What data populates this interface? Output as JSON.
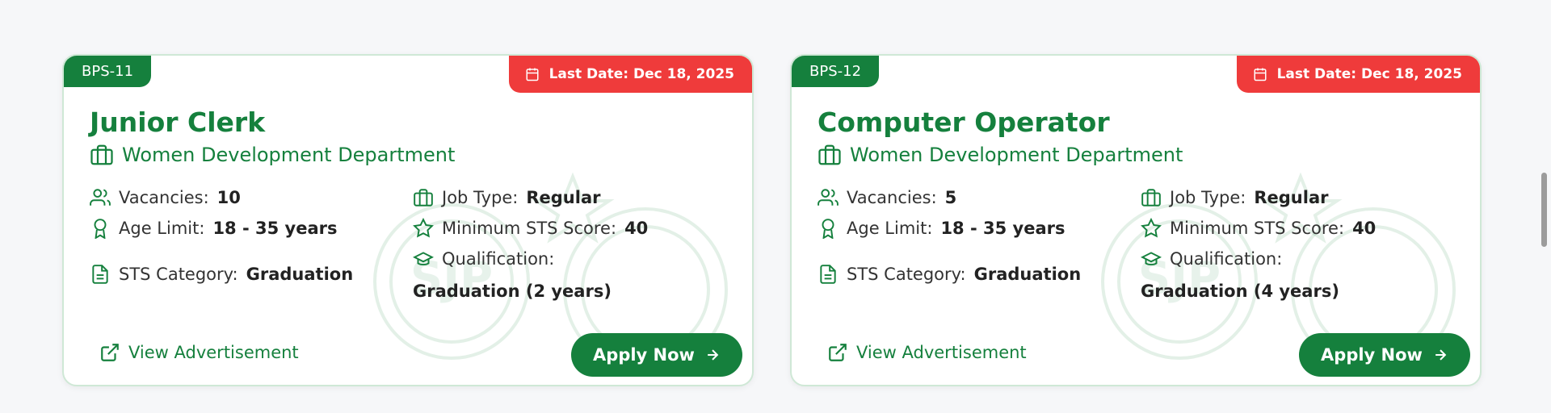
{
  "cards": [
    {
      "bps": "BPS-11",
      "last_date": "Last Date: Dec 18, 2025",
      "title": "Junior Clerk",
      "department": "Women Development Department",
      "vacancies_label": "Vacancies:",
      "vacancies_value": "10",
      "age_label": "Age Limit:",
      "age_value": "18 - 35 years",
      "sts_category_label": "STS Category:",
      "sts_category_value": "Graduation",
      "job_type_label": "Job Type:",
      "job_type_value": "Regular",
      "min_sts_label": "Minimum STS Score:",
      "min_sts_value": "40",
      "qualification_label": "Qualification:",
      "qualification_value": "Graduation (2 years)",
      "view_ad": "View Advertisement",
      "apply": "Apply Now"
    },
    {
      "bps": "BPS-12",
      "last_date": "Last Date: Dec 18, 2025",
      "title": "Computer Operator",
      "department": "Women Development Department",
      "vacancies_label": "Vacancies:",
      "vacancies_value": "5",
      "age_label": "Age Limit:",
      "age_value": "18 - 35 years",
      "sts_category_label": "STS Category:",
      "sts_category_value": "Graduation",
      "job_type_label": "Job Type:",
      "job_type_value": "Regular",
      "min_sts_label": "Minimum STS Score:",
      "min_sts_value": "40",
      "qualification_label": "Qualification:",
      "qualification_value": "Graduation (4 years)",
      "view_ad": "View Advertisement",
      "apply": "Apply Now"
    }
  ],
  "watermark_text": "SJP",
  "icons": {
    "calendar": "calendar-icon",
    "department": "briefcase-icon",
    "vacancies": "users-icon",
    "age": "award-icon",
    "sts_category": "document-icon",
    "job_type": "briefcase-icon",
    "min_sts": "star-icon",
    "qualification": "graduation-cap-icon",
    "view_ad": "external-link-icon",
    "apply": "arrow-right-icon"
  },
  "colors": {
    "brand_green": "#15803d",
    "deadline_red": "#ef3b3b",
    "card_border": "#cfe8d6",
    "page_bg": "#f6f7f9"
  }
}
